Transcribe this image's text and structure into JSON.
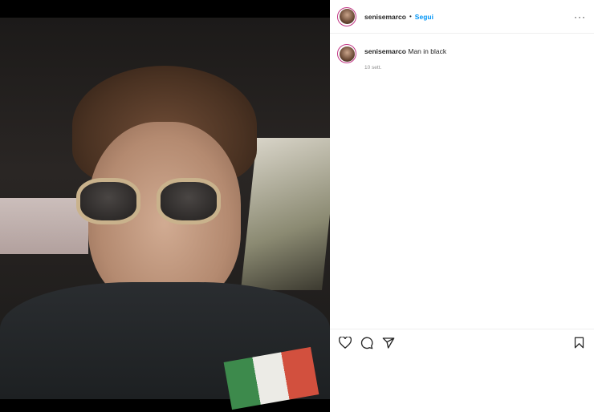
{
  "post": {
    "username": "senisemarco",
    "separator": "•",
    "follow_label": "Segui",
    "more_label": "···",
    "caption_user": "senisemarco",
    "caption_text": "Man in black",
    "timestamp": "10 sett."
  },
  "icons": {
    "like": "heart-icon",
    "comment": "comment-icon",
    "share": "send-icon",
    "save": "bookmark-icon"
  },
  "colors": {
    "follow": "#0095f6",
    "story_ring": "#c13584"
  }
}
